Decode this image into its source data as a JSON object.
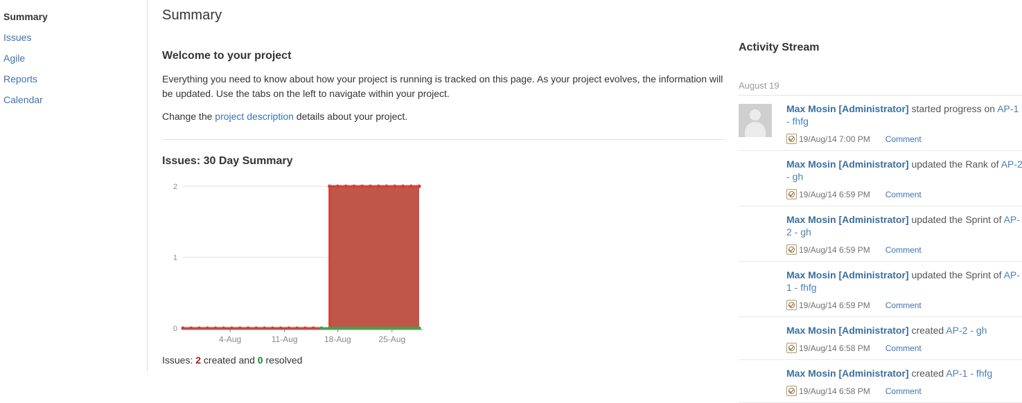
{
  "sidebar": {
    "items": [
      {
        "label": "Summary",
        "active": true
      },
      {
        "label": "Issues",
        "active": false
      },
      {
        "label": "Agile",
        "active": false
      },
      {
        "label": "Reports",
        "active": false
      },
      {
        "label": "Calendar",
        "active": false
      }
    ]
  },
  "main": {
    "page_title": "Summary",
    "welcome_heading": "Welcome to your project",
    "welcome_paragraph": "Everything you need to know about how your project is running is tracked on this page. As your project evolves, the information will be updated. Use the tabs on the left to navigate within your project.",
    "change_prefix": "Change the ",
    "change_link": "project description",
    "change_suffix": " details about your project.",
    "chart_heading": "Issues: 30 Day Summary",
    "chart_footer": {
      "prefix": "Issues: ",
      "created_count": "2",
      "middle": " created and ",
      "resolved_count": "0",
      "suffix": " resolved"
    }
  },
  "chart_data": {
    "type": "area",
    "title": "Issues: 30 Day Summary",
    "xlabel": "",
    "ylabel": "",
    "ylim": [
      0,
      2
    ],
    "yticks": [
      "0",
      "1",
      "2"
    ],
    "xticks": [
      "4-Aug",
      "11-Aug",
      "18-Aug",
      "25-Aug"
    ],
    "xtick_positions": [
      0.2,
      0.43,
      0.655,
      0.885
    ],
    "grid": true,
    "legend": "none",
    "colors": {
      "created_line": "#d93b36",
      "created_fill": "#c0564a",
      "resolved_line": "#3ba743",
      "grid": "#e0e0e0",
      "axis": "#8b8b8b",
      "tick_label": "#888888"
    },
    "x": [
      "1-Aug",
      "2-Aug",
      "3-Aug",
      "4-Aug",
      "5-Aug",
      "6-Aug",
      "7-Aug",
      "8-Aug",
      "9-Aug",
      "10-Aug",
      "11-Aug",
      "12-Aug",
      "13-Aug",
      "14-Aug",
      "15-Aug",
      "16-Aug",
      "17-Aug",
      "18-Aug",
      "19-Aug",
      "20-Aug",
      "21-Aug",
      "22-Aug",
      "23-Aug",
      "24-Aug",
      "25-Aug",
      "26-Aug",
      "27-Aug",
      "28-Aug",
      "29-Aug",
      "30-Aug"
    ],
    "series": [
      {
        "name": "created",
        "color": "#d93b36",
        "values": [
          0,
          0,
          0,
          0,
          0,
          0,
          0,
          0,
          0,
          0,
          0,
          0,
          0,
          0,
          0,
          0,
          0,
          0,
          2,
          2,
          2,
          2,
          2,
          2,
          2,
          2,
          2,
          2,
          2,
          2
        ]
      },
      {
        "name": "resolved",
        "color": "#3ba743",
        "values": [
          null,
          null,
          null,
          null,
          null,
          null,
          null,
          null,
          null,
          null,
          null,
          null,
          null,
          null,
          null,
          null,
          null,
          0,
          0,
          0,
          0,
          0,
          0,
          0,
          0,
          0,
          0,
          0,
          0,
          0
        ]
      }
    ]
  },
  "activity": {
    "title": "Activity Stream",
    "date_header": "August 19",
    "comment_label": "Comment",
    "items": [
      {
        "actor": "Max Mosin [Administrator]",
        "action": " started progress on ",
        "issue": "AP-1 - fhfg",
        "timestamp": "19/Aug/14 7:00 PM",
        "has_avatar": true
      },
      {
        "actor": "Max Mosin [Administrator]",
        "action": " updated the Rank of ",
        "issue": "AP-2 - gh",
        "timestamp": "19/Aug/14 6:59 PM",
        "has_avatar": false
      },
      {
        "actor": "Max Mosin [Administrator]",
        "action": " updated the Sprint of ",
        "issue": "AP-2 - gh",
        "timestamp": "19/Aug/14 6:59 PM",
        "has_avatar": false
      },
      {
        "actor": "Max Mosin [Administrator]",
        "action": " updated the Sprint of ",
        "issue": "AP-1 - fhfg",
        "timestamp": "19/Aug/14 6:59 PM",
        "has_avatar": false
      },
      {
        "actor": "Max Mosin [Administrator]",
        "action": " created ",
        "issue": "AP-2 - gh",
        "timestamp": "19/Aug/14 6:58 PM",
        "has_avatar": false
      },
      {
        "actor": "Max Mosin [Administrator]",
        "action": " created ",
        "issue": "AP-1 - fhfg",
        "timestamp": "19/Aug/14 6:58 PM",
        "has_avatar": false
      }
    ]
  }
}
